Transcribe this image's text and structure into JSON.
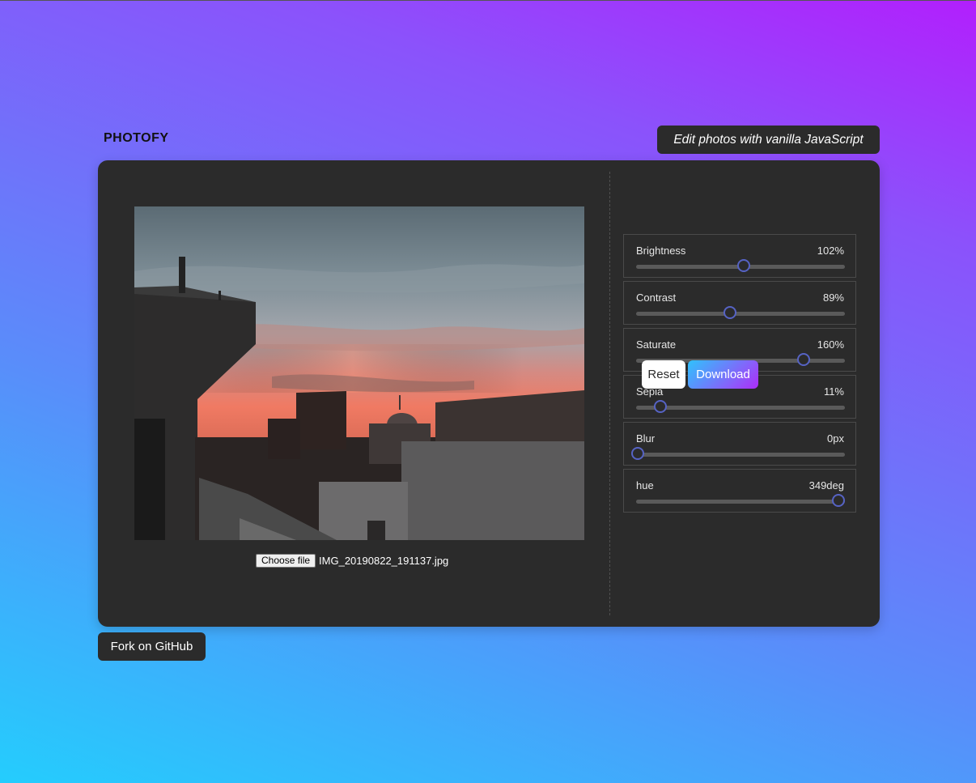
{
  "header": {
    "brand": "PHOTOFY",
    "tagline": "Edit photos with vanilla JavaScript"
  },
  "editor": {
    "file_button_label": "Choose file",
    "file_name": "IMG_20190822_191137.jpg",
    "image_icon": "photo-preview",
    "filters": [
      {
        "label": "Brightness",
        "value_text": "102%",
        "value": 102,
        "min": 0,
        "max": 200
      },
      {
        "label": "Contrast",
        "value_text": "89%",
        "value": 89,
        "min": 0,
        "max": 200
      },
      {
        "label": "Saturate",
        "value_text": "160%",
        "value": 160,
        "min": 0,
        "max": 200
      },
      {
        "label": "Sepia",
        "value_text": "11%",
        "value": 11,
        "min": 0,
        "max": 100
      },
      {
        "label": "Blur",
        "value_text": "0px",
        "value": 0,
        "min": 0,
        "max": 10
      },
      {
        "label": "hue",
        "value_text": "349deg",
        "value": 349,
        "min": 0,
        "max": 360
      }
    ],
    "reset_label": "Reset",
    "download_label": "Download"
  },
  "footer": {
    "github_label": "Fork on GitHub"
  },
  "colors": {
    "card_bg": "#2b2b2b",
    "slider_thumb": "#5663c4",
    "gradient_start": "#b21ffd",
    "gradient_end": "#24cdfd"
  }
}
